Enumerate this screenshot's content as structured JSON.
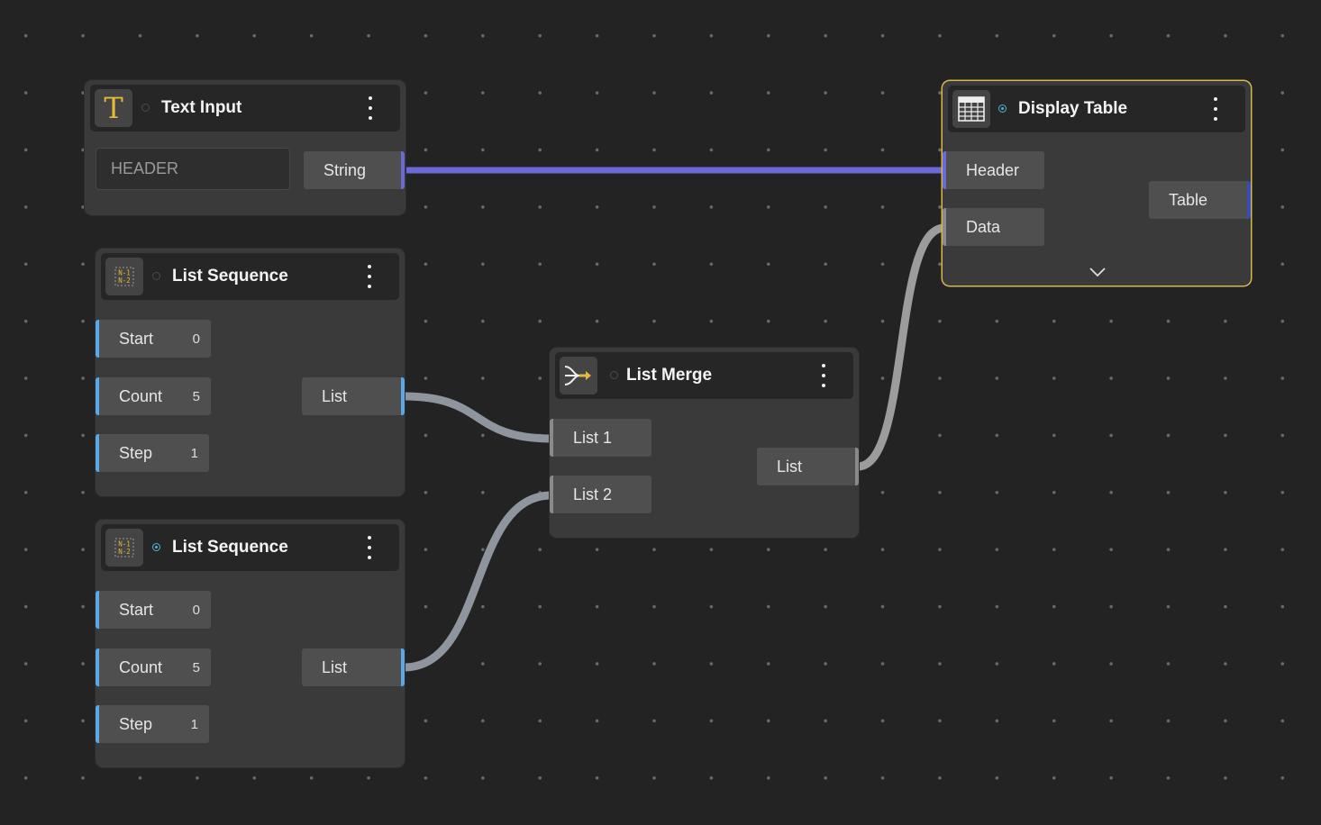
{
  "colors": {
    "accent_blue": "#5aa9e6",
    "string_wire": "#6c6ad6",
    "list_wire": "#8e959c",
    "data_wire": "#9c9c9c",
    "selection": "#d6b84a",
    "text_icon": "#e6b93a"
  },
  "nodes": {
    "text_input": {
      "title": "Text Input",
      "icon": "text-t-icon",
      "icon_glyph": "T",
      "field_value": "HEADER",
      "output": "String"
    },
    "seq1": {
      "title": "List Sequence",
      "icon": "list-sequence-icon",
      "inputs": [
        {
          "label": "Start",
          "value": "0"
        },
        {
          "label": "Count",
          "value": "5"
        },
        {
          "label": "Step",
          "value": "1"
        }
      ],
      "output": "List"
    },
    "seq2": {
      "title": "List Sequence",
      "icon": "list-sequence-icon",
      "inputs": [
        {
          "label": "Start",
          "value": "0"
        },
        {
          "label": "Count",
          "value": "5"
        },
        {
          "label": "Step",
          "value": "1"
        }
      ],
      "output": "List"
    },
    "merge": {
      "title": "List Merge",
      "icon": "list-merge-icon",
      "inputs": [
        {
          "label": "List 1"
        },
        {
          "label": "List 2"
        }
      ],
      "output": "List"
    },
    "display": {
      "title": "Display Table",
      "icon": "table-icon",
      "inputs": [
        {
          "label": "Header"
        },
        {
          "label": "Data"
        }
      ],
      "output": "Table",
      "expand_icon": "chevron-down-icon"
    }
  }
}
